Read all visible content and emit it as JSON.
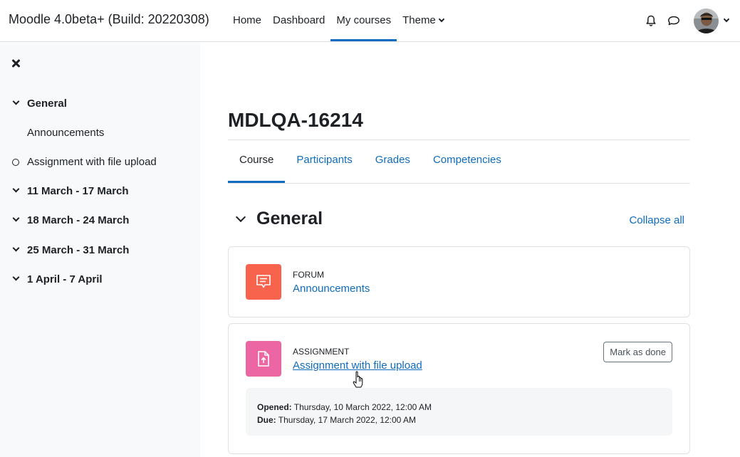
{
  "navbar": {
    "brand": "Moodle 4.0beta+ (Build: 20220308)",
    "items": [
      {
        "label": "Home"
      },
      {
        "label": "Dashboard"
      },
      {
        "label": "My courses"
      },
      {
        "label": "Theme"
      }
    ],
    "icons": [
      "bell-icon",
      "chat-bubble-icon"
    ],
    "accent": "#0f6cbf"
  },
  "drawer": {
    "close_icon": "close-icon",
    "items": [
      {
        "label": "General",
        "icon": "chevron-down-icon"
      },
      {
        "label": "Announcements"
      },
      {
        "label": "Assignment with file upload",
        "icon": "circle-icon"
      },
      {
        "label": "11 March - 17 March",
        "icon": "chevron-down-icon"
      },
      {
        "label": "18 March - 24 March",
        "icon": "chevron-down-icon"
      },
      {
        "label": "25 March - 31 March",
        "icon": "chevron-down-icon"
      },
      {
        "label": "1 April - 7 April",
        "icon": "chevron-down-icon"
      }
    ]
  },
  "course": {
    "title": "MDLQA-16214",
    "tabs": [
      {
        "label": "Course"
      },
      {
        "label": "Participants"
      },
      {
        "label": "Grades"
      },
      {
        "label": "Competencies"
      }
    ]
  },
  "section": {
    "name": "General",
    "collapse_all": "Collapse all"
  },
  "activities": [
    {
      "type": "FORUM",
      "name": "Announcements",
      "icon": "forum-icon",
      "color": "#f7634d"
    },
    {
      "type": "ASSIGNMENT",
      "name": "Assignment with file upload",
      "icon": "file-upload-icon",
      "color": "#eb66a2",
      "mark_done": "Mark as done",
      "opened_label": "Opened:",
      "opened_value": "Thursday, 10 March 2022, 12:00 AM",
      "due_label": "Due:",
      "due_value": "Thursday, 17 March 2022, 12:00 AM"
    }
  ]
}
